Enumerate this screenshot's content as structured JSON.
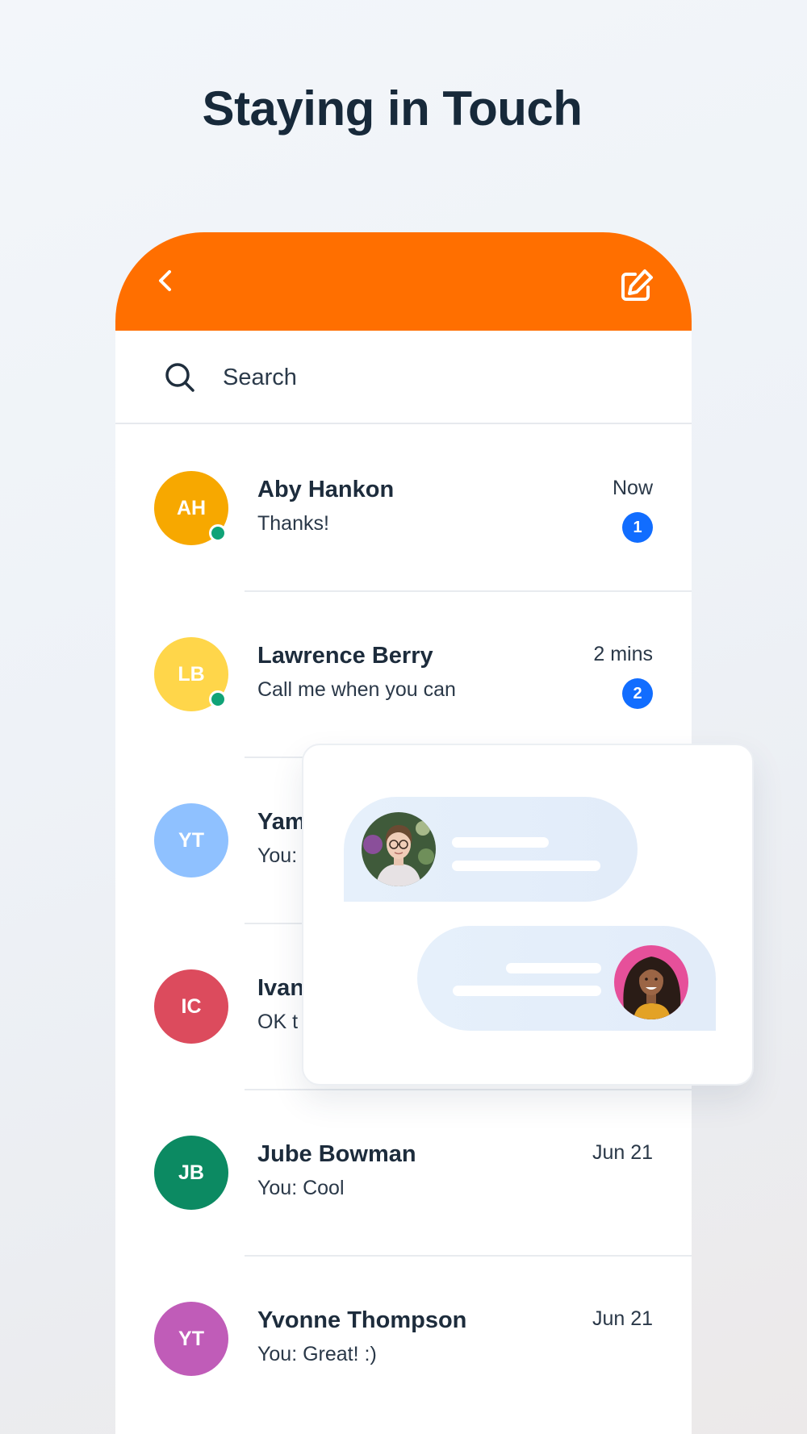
{
  "page": {
    "headline": "Staying in Touch"
  },
  "app": {
    "header_color": "#ff6f00",
    "back_icon": "chevron-left-icon",
    "compose_icon": "compose-edit-icon"
  },
  "search": {
    "icon": "search-icon",
    "placeholder": "Search",
    "value": ""
  },
  "conversations": [
    {
      "initials": "AH",
      "name": "Aby Hankon",
      "preview": "Thanks!",
      "time": "Now",
      "unread": "1",
      "online": true,
      "avatar_color": "#f7a800"
    },
    {
      "initials": "LB",
      "name": "Lawrence Berry",
      "preview": "Call me when you can",
      "time": "2 mins",
      "unread": "2",
      "online": true,
      "avatar_color": "#ffd64a"
    },
    {
      "initials": "YT",
      "name": "Yam",
      "preview": "You:",
      "time": "",
      "unread": "",
      "online": false,
      "avatar_color": "#8fc1ff"
    },
    {
      "initials": "IC",
      "name": "Ivan",
      "preview": "OK t",
      "time": "",
      "unread": "",
      "online": false,
      "avatar_color": "#dc4b5d"
    },
    {
      "initials": "JB",
      "name": "Jube Bowman",
      "preview": "You: Cool",
      "time": "Jun 21",
      "unread": "",
      "online": false,
      "avatar_color": "#0c8a62"
    },
    {
      "initials": "YT",
      "name": "Yvonne Thompson",
      "preview": "You: Great! :)",
      "time": "Jun 21",
      "unread": "",
      "online": false,
      "avatar_color": "#c05cb8"
    }
  ],
  "overlay": {
    "bubble_color": "#e4eefa",
    "messages": [
      {
        "side": "left",
        "avatar": "woman-with-glasses-photo"
      },
      {
        "side": "right",
        "avatar": "smiling-woman-curly-hair-photo"
      }
    ]
  }
}
